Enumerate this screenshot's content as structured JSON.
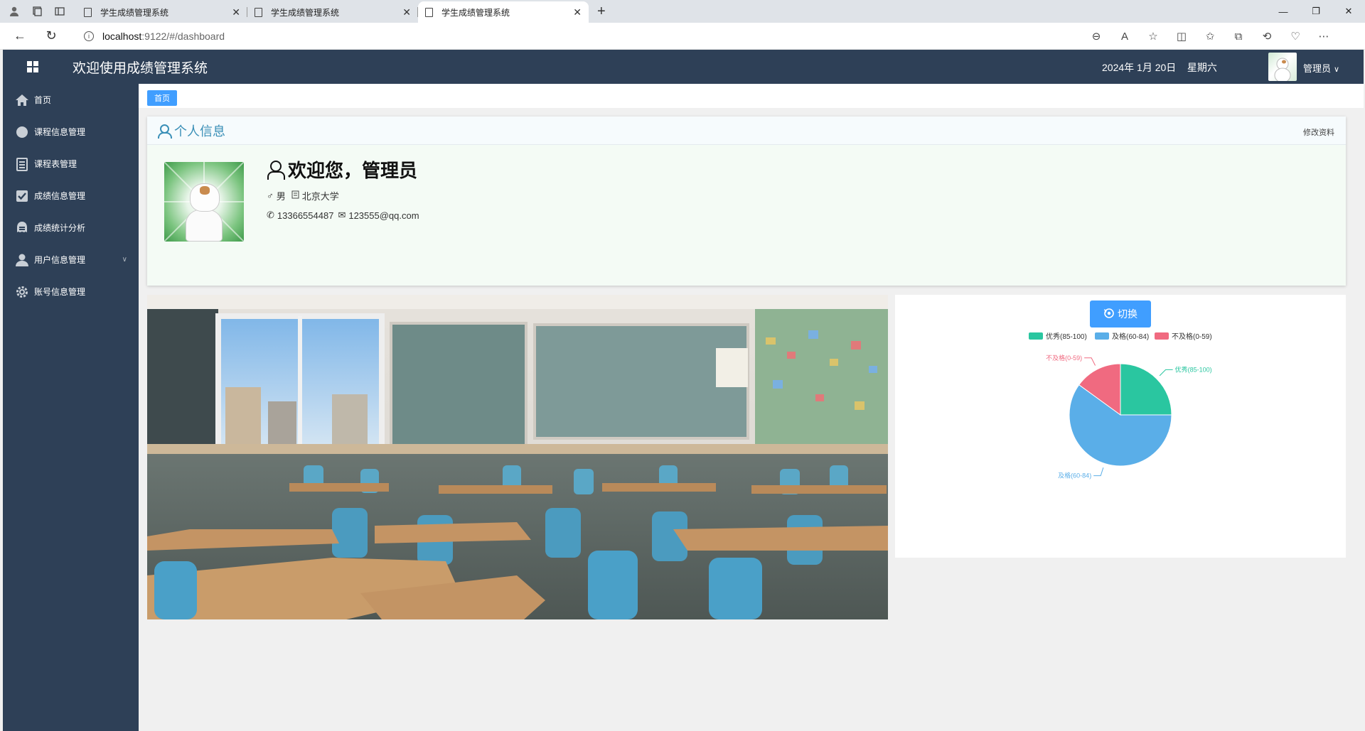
{
  "browser": {
    "tabs": [
      {
        "title": "学生成绩管理系统"
      },
      {
        "title": "学生成绩管理系统"
      },
      {
        "title": "学生成绩管理系统"
      }
    ],
    "url_host": "localhost",
    "url_path": ":9122/#/dashboard",
    "accent": "#409eff"
  },
  "header": {
    "title": "欢迎使用成绩管理系统",
    "date": "2024年 1月 20日",
    "weekday": "星期六",
    "user": "管理员"
  },
  "sidebar": {
    "items": [
      {
        "label": "首页",
        "icon": "home-icon"
      },
      {
        "label": "课程信息管理",
        "icon": "course-icon"
      },
      {
        "label": "课程表管理",
        "icon": "schedule-icon"
      },
      {
        "label": "成绩信息管理",
        "icon": "check-icon"
      },
      {
        "label": "成绩统计分析",
        "icon": "stats-icon"
      },
      {
        "label": "用户信息管理",
        "icon": "user-icon"
      },
      {
        "label": "账号信息管理",
        "icon": "gear-icon"
      }
    ]
  },
  "tags": {
    "home": "首页"
  },
  "profile": {
    "title": "个人信息",
    "edit": "修改资料",
    "welcome": "欢迎您，管理员",
    "gender_symbol": "♂",
    "gender": "男",
    "school": "北京大学",
    "phone": "13366554487",
    "email": "123555@qq.com"
  },
  "chart": {
    "switch_label": "切换",
    "colors": [
      "#2ac6a0",
      "#5aaee8",
      "#f06a80"
    ]
  },
  "chart_data": {
    "type": "pie",
    "title": "",
    "categories": [
      "优秀(85-100)",
      "及格(60-84)",
      "不及格(0-59)"
    ],
    "values": [
      25,
      60,
      15
    ],
    "legend_position": "top"
  }
}
